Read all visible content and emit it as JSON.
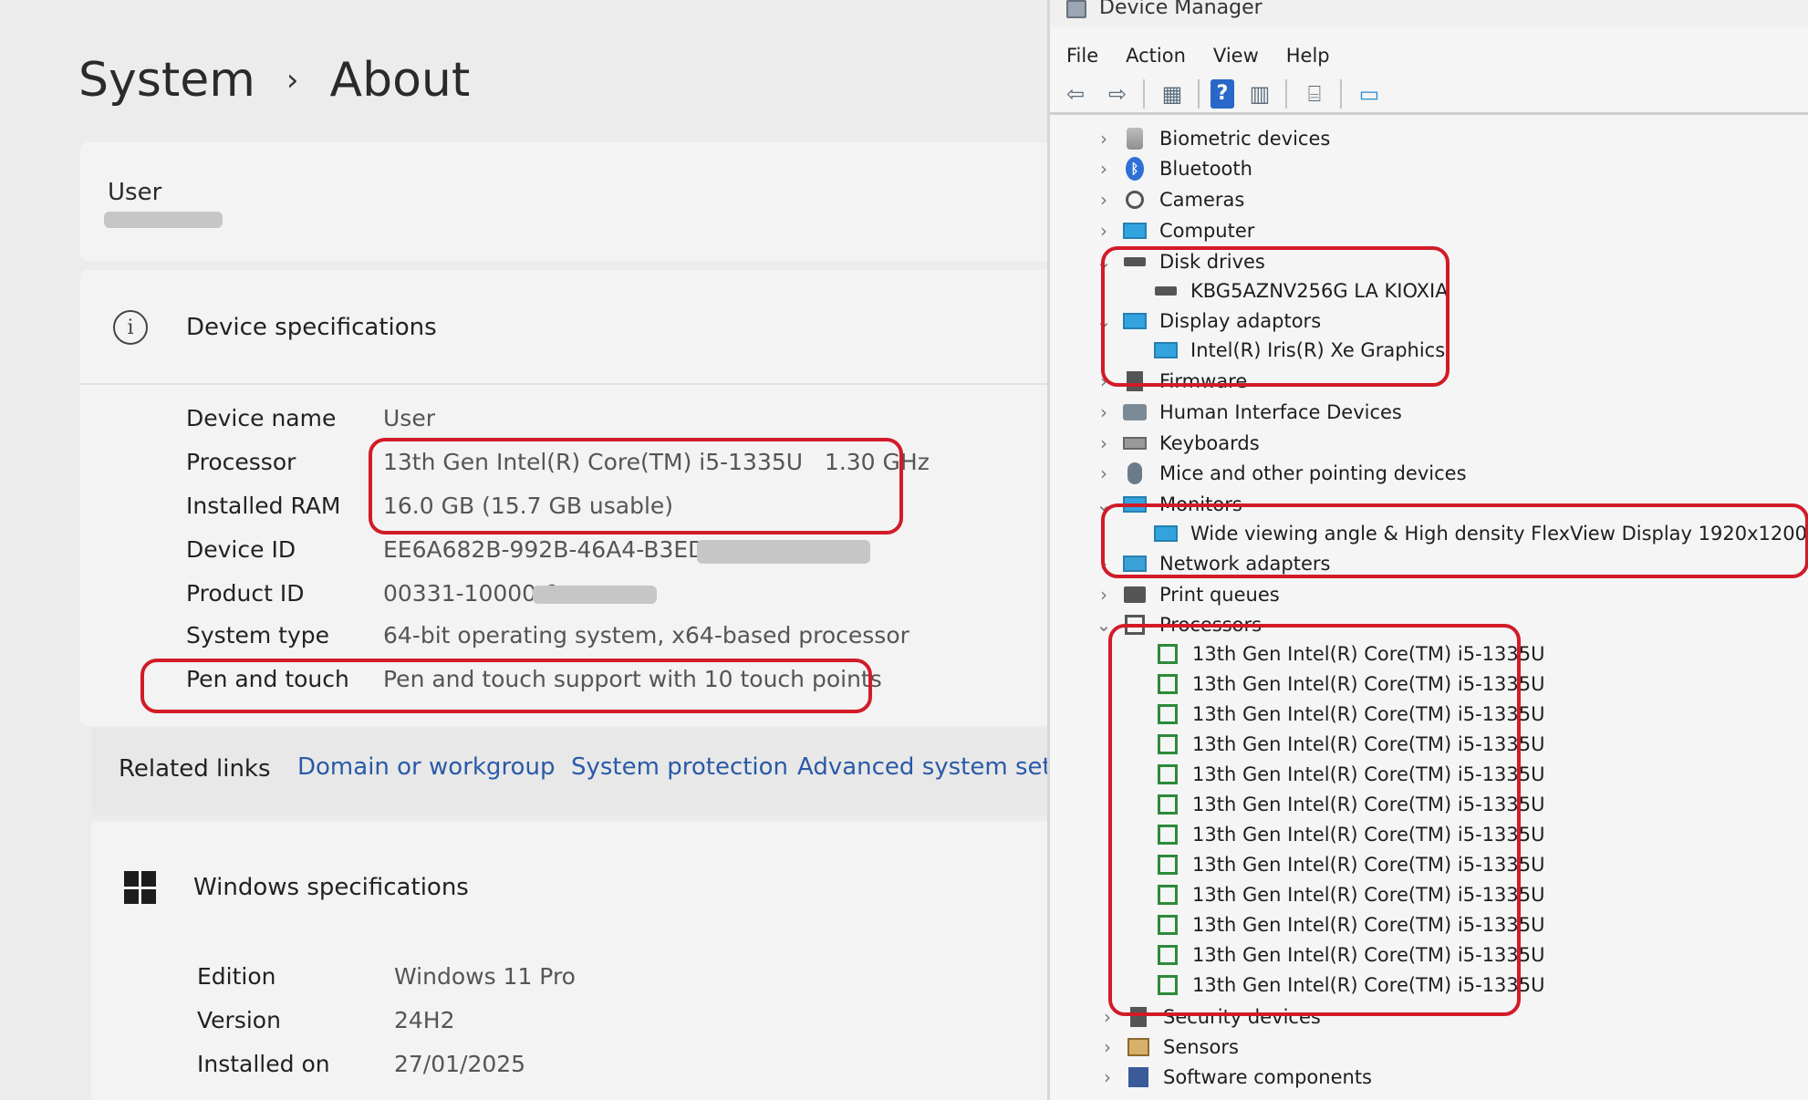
{
  "settings": {
    "breadcrumb": {
      "parent": "System",
      "separator": "›",
      "current": "About"
    },
    "user_card": {
      "label": "User"
    },
    "device_specs": {
      "title": "Device specifications",
      "rows": [
        {
          "key": "Device name",
          "value": "User"
        },
        {
          "key": "Processor",
          "value": "13th Gen Intel(R) Core(TM) i5-1335U   1.30 GHz"
        },
        {
          "key": "Installed RAM",
          "value": "16.0 GB (15.7 GB usable)"
        },
        {
          "key": "Device ID",
          "value": "EE6A682B-992B-46A4-B3ED-"
        },
        {
          "key": "Product ID",
          "value": "00331-10000-0"
        },
        {
          "key": "System type",
          "value": "64-bit operating system, x64-based processor"
        },
        {
          "key": "Pen and touch",
          "value": "Pen and touch support with 10 touch points"
        }
      ]
    },
    "related": {
      "label": "Related links",
      "links": [
        "Domain or workgroup",
        "System protection",
        "Advanced system setting"
      ]
    },
    "windows_specs": {
      "title": "Windows specifications",
      "rows": [
        {
          "key": "Edition",
          "value": "Windows 11 Pro"
        },
        {
          "key": "Version",
          "value": "24H2"
        },
        {
          "key": "Installed on",
          "value": "27/01/2025"
        }
      ]
    }
  },
  "device_manager": {
    "title": "Device Manager",
    "menu": [
      "File",
      "Action",
      "View",
      "Help"
    ],
    "toolbar_icons": [
      "back-arrow-icon",
      "forward-arrow-icon",
      "properties-icon",
      "help-icon",
      "details-icon",
      "scan-hardware-icon",
      "monitor-icon"
    ],
    "tree": {
      "biometric": "Biometric devices",
      "bluetooth": "Bluetooth",
      "cameras": "Cameras",
      "computer": "Computer",
      "disk_drives": "Disk drives",
      "disk_child": "KBG5AZNV256G LA KIOXIA",
      "display": "Display adaptors",
      "display_child": "Intel(R) Iris(R) Xe Graphics",
      "firmware": "Firmware",
      "hid": "Human Interface Devices",
      "keyboards": "Keyboards",
      "mice": "Mice and other pointing devices",
      "monitors": "Monitors",
      "monitor_child": "Wide viewing angle & High density FlexView Display 1920x1200",
      "network": "Network adapters",
      "print": "Print queues",
      "processors": "Processors",
      "processor_child": "13th Gen Intel(R) Core(TM) i5-1335U",
      "security": "Security devices",
      "sensors": "Sensors",
      "software": "Software components"
    }
  },
  "colors": {
    "highlight": "#d21b28",
    "link": "#2a5aa8"
  }
}
